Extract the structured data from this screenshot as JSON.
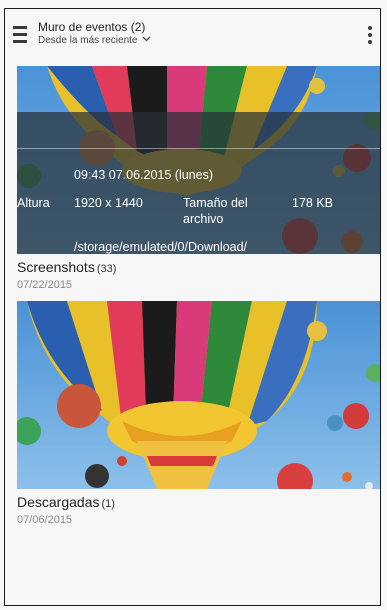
{
  "header": {
    "title": "Muro de eventos (2)",
    "sort_label": "Desde la más reciente",
    "menu_icon": "hamburger-menu-icon",
    "sort_icon": "chevron-down-icon",
    "more_icon": "more-vertical-icon"
  },
  "albums": [
    {
      "name": "Screenshots",
      "count": "(33)",
      "date": "07/22/2015",
      "overlay": {
        "timestamp": "09:43 07.06.2015 (lunes)",
        "height_label": "Altura",
        "resolution": "1920 x 1440",
        "size_label_line1": "Tamaño del",
        "size_label_line2": "archivo",
        "size_value": "178 KB",
        "path": "/storage/emulated/0/Download/"
      }
    },
    {
      "name": "Descargadas",
      "count": "(1)",
      "date": "07/06/2015"
    }
  ],
  "colors": {
    "background": "#f7f7f7",
    "sky": "#5b9fd8",
    "text_primary": "#222222",
    "text_secondary": "#888888"
  }
}
